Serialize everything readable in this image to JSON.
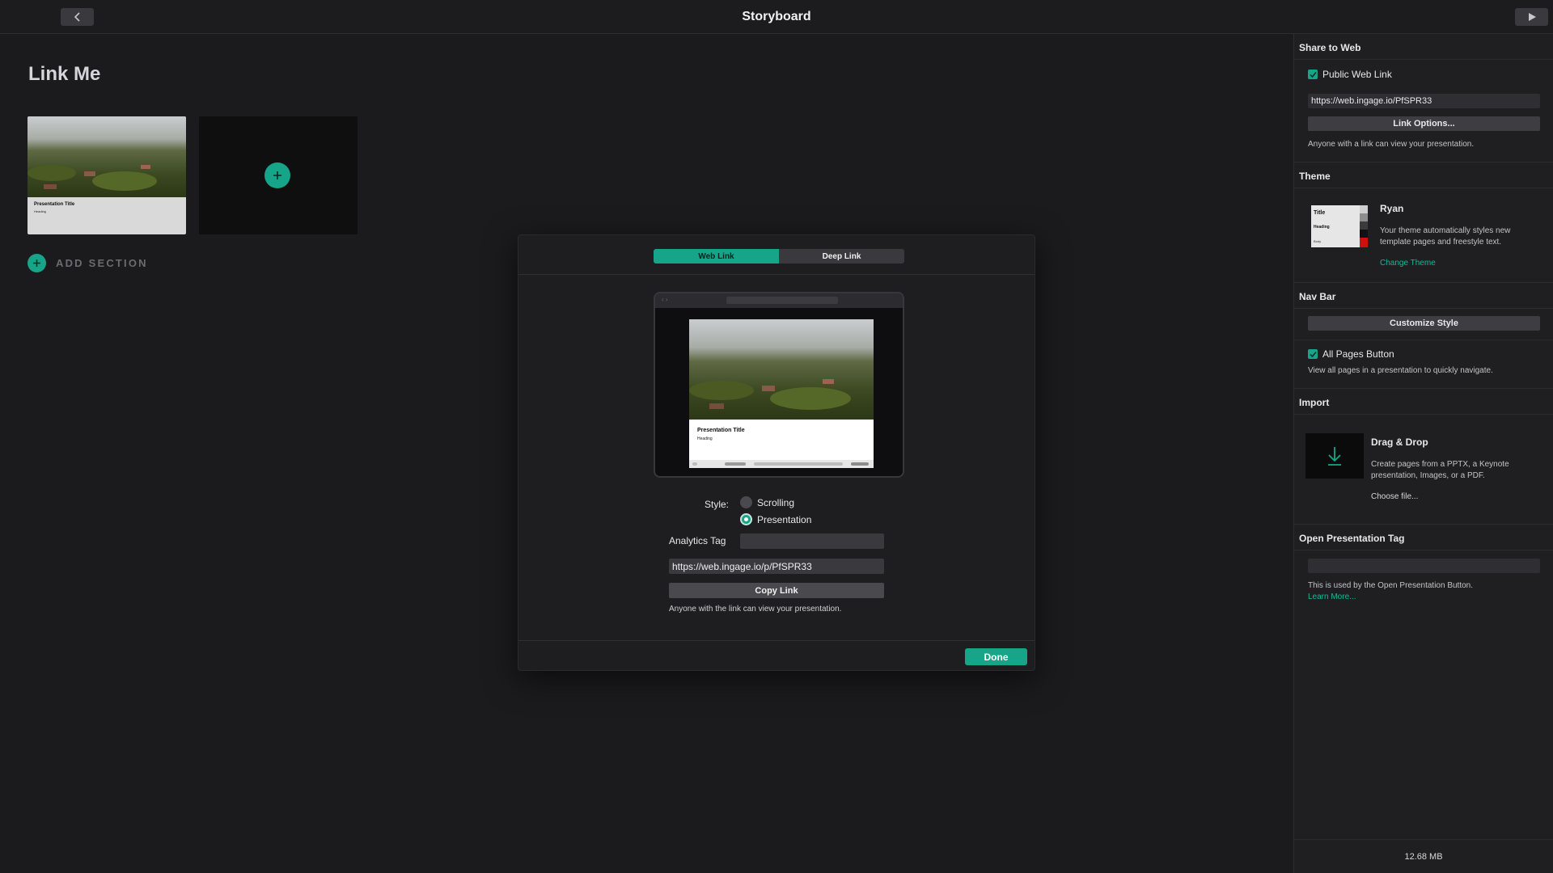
{
  "window": {
    "title": "Storyboard"
  },
  "canvas": {
    "page_title": "Link Me",
    "thumbnail": {
      "title": "Presentation Title",
      "heading": "Heading"
    },
    "add_section_label": "ADD SECTION"
  },
  "modal": {
    "tabs": [
      {
        "label": "Web Link",
        "active": true
      },
      {
        "label": "Deep Link",
        "active": false
      }
    ],
    "preview": {
      "title": "Presentation Title",
      "heading": "Heading"
    },
    "style_label": "Style:",
    "style_options": [
      {
        "label": "Scrolling",
        "selected": false
      },
      {
        "label": "Presentation",
        "selected": true
      }
    ],
    "analytics_label": "Analytics Tag",
    "analytics_value": "",
    "link_url": "https://web.ingage.io/p/PfSPR33",
    "copy_button": "Copy Link",
    "note": "Anyone with the link can view your presentation.",
    "done_button": "Done"
  },
  "panel": {
    "share": {
      "heading": "Share to Web",
      "public_link_label": "Public Web Link",
      "public_link_checked": true,
      "url": "https://web.ingage.io/PfSPR33",
      "options_button": "Link Options...",
      "note": "Anyone with a link can view your presentation."
    },
    "theme": {
      "heading": "Theme",
      "thumb_title": "Title",
      "thumb_heading": "Heading",
      "thumb_body": "Body",
      "name": "Ryan",
      "description": "Your theme automatically styles new template pages and freestyle text.",
      "change_link": "Change Theme"
    },
    "nav_bar": {
      "heading": "Nav Bar",
      "customize_button": "Customize Style",
      "all_pages_label": "All Pages Button",
      "all_pages_checked": true,
      "note": "View all pages in a presentation to quickly navigate."
    },
    "import": {
      "heading": "Import",
      "title": "Drag & Drop",
      "description": "Create pages from a PPTX, a Keynote presentation, Images, or a PDF.",
      "choose_file": "Choose file..."
    },
    "open_tag": {
      "heading": "Open Presentation Tag",
      "value": "",
      "note": "This is used by the Open Presentation Button.",
      "learn_more": "Learn More..."
    },
    "file_size": "12.68 MB"
  },
  "colors": {
    "accent": "#17a589",
    "background": "#1b1b1e",
    "panel": "#1f1f22"
  },
  "icons": {
    "back": "chevron-left-icon",
    "play": "play-icon",
    "add": "plus-icon",
    "import": "download-arrow-icon",
    "check": "checkmark-icon"
  }
}
